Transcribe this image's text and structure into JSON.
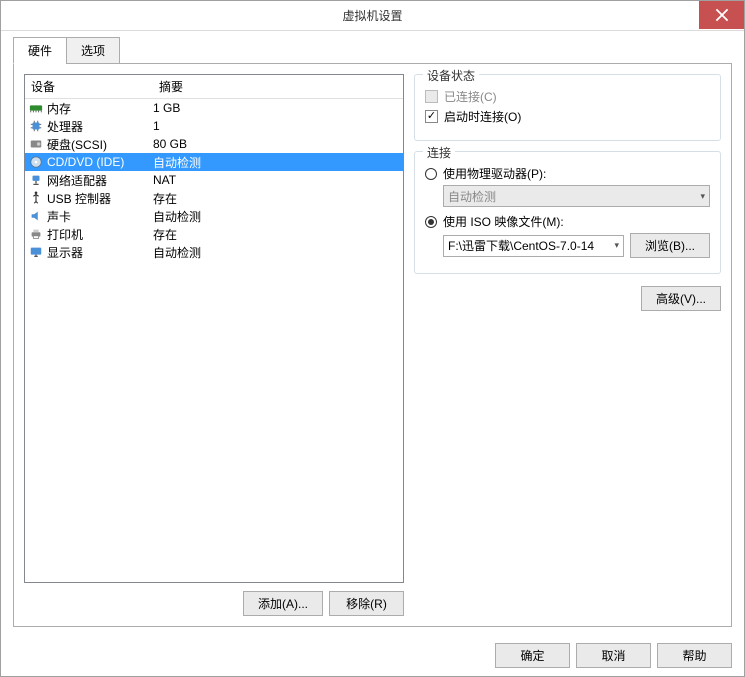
{
  "title": "虚拟机设置",
  "tabs": {
    "hardware": "硬件",
    "options": "选项"
  },
  "table": {
    "header_device": "设备",
    "header_summary": "摘要",
    "rows": [
      {
        "name": "内存",
        "summary": "1 GB"
      },
      {
        "name": "处理器",
        "summary": "1"
      },
      {
        "name": "硬盘(SCSI)",
        "summary": "80 GB"
      },
      {
        "name": "CD/DVD (IDE)",
        "summary": "自动检测"
      },
      {
        "name": "网络适配器",
        "summary": "NAT"
      },
      {
        "name": "USB 控制器",
        "summary": "存在"
      },
      {
        "name": "声卡",
        "summary": "自动检测"
      },
      {
        "name": "打印机",
        "summary": "存在"
      },
      {
        "name": "显示器",
        "summary": "自动检测"
      }
    ]
  },
  "buttons": {
    "add": "添加(A)...",
    "remove": "移除(R)",
    "browse": "浏览(B)...",
    "advanced": "高级(V)...",
    "ok": "确定",
    "cancel": "取消",
    "help": "帮助"
  },
  "status": {
    "title": "设备状态",
    "connected": "已连接(C)",
    "connect_on_start": "启动时连接(O)"
  },
  "connection": {
    "title": "连接",
    "use_physical": "使用物理驱动器(P):",
    "auto_detect": "自动检测",
    "use_iso": "使用 ISO 映像文件(M):",
    "iso_path": "F:\\迅雷下载\\CentOS-7.0-14"
  }
}
